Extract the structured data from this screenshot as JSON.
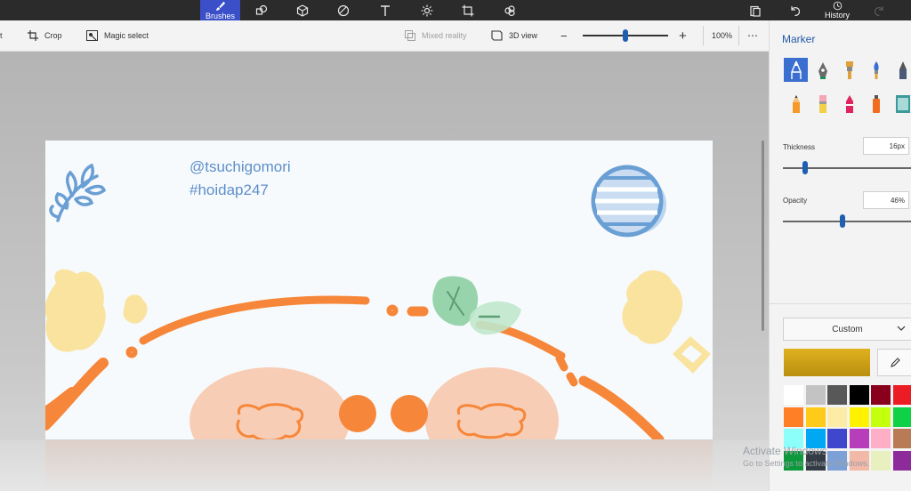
{
  "topbar": {
    "brushes_label": "Brushes",
    "history_label": "History"
  },
  "toolbar": {
    "crop_label": "Crop",
    "magic_select_label": "Magic select",
    "mixed_reality_label": "Mixed reality",
    "view_3d_label": "3D view",
    "zoom_level": "100%",
    "zoom_fraction": 0.5
  },
  "canvas": {
    "line1": "@tsuchigomori",
    "line2": "#hoidap247"
  },
  "side_panel": {
    "title": "Marker",
    "thickness_label": "Thickness",
    "thickness_value": "16px",
    "thickness_fraction": 0.17,
    "opacity_label": "Opacity",
    "opacity_value": "46%",
    "opacity_fraction": 0.46,
    "color_mode": "Custom",
    "current_color": "#e0b01e",
    "palette_rows": [
      [
        "#ffffff",
        "#c3c3c3",
        "#585858",
        "#000000",
        "#88001b",
        "#ec1c24"
      ],
      [
        "#ff7f27",
        "#ffca18",
        "#fdeca6",
        "#fff200",
        "#c4ff0e",
        "#0ed145"
      ],
      [
        "#8cfffb",
        "#00a8f3",
        "#3f48cc",
        "#b83dba",
        "#ffaec8",
        "#b97a56"
      ],
      [
        "#0e9a3c",
        "#333c44",
        "#7da1d6",
        "#f2b8a8",
        "#e8f0c0",
        "#8e2b9a"
      ]
    ]
  },
  "watermark": {
    "line1": "Activate Windows",
    "line2": "Go to Settings to activate Windows."
  }
}
